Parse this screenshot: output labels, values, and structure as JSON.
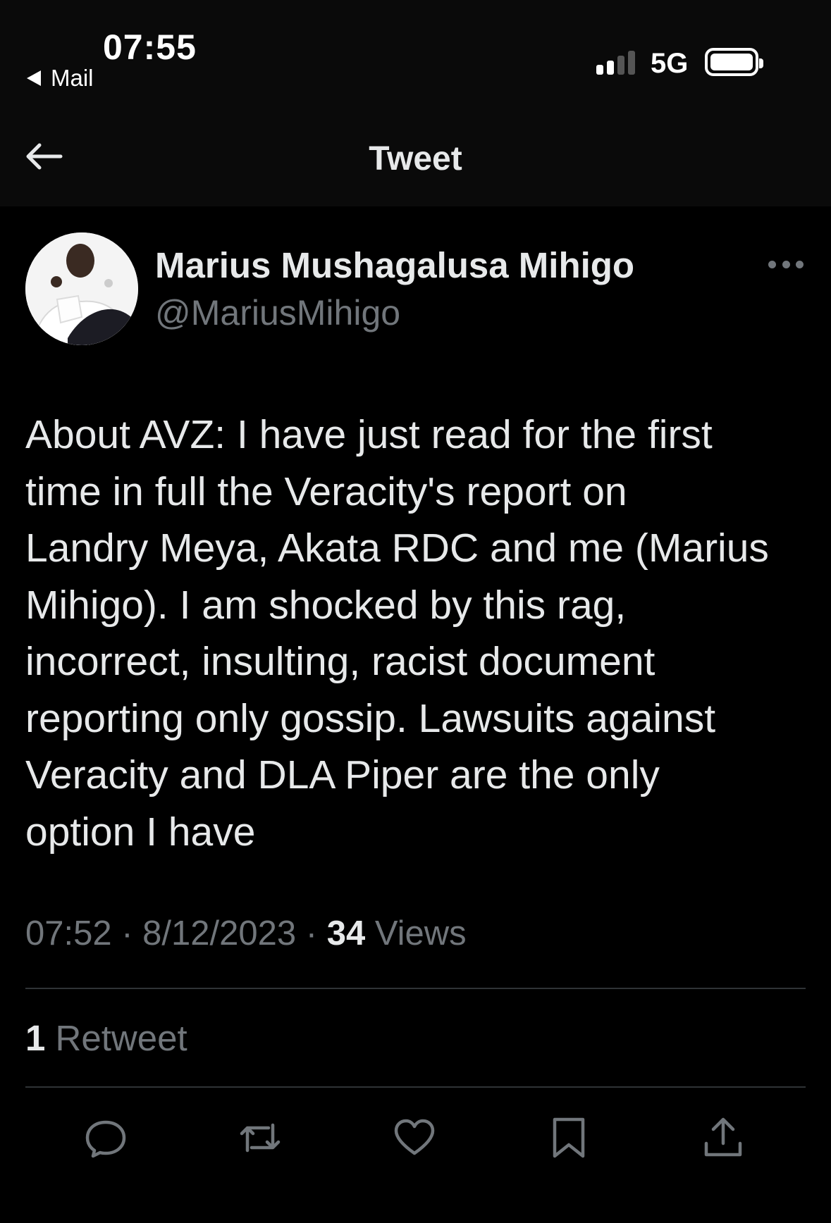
{
  "status_bar": {
    "time": "07:55",
    "back_app": "Mail",
    "network": "5G",
    "signal_icon": "signal-bars-icon",
    "battery_icon": "battery-icon"
  },
  "header": {
    "title": "Tweet",
    "back_icon": "arrow-left-icon"
  },
  "tweet": {
    "author": {
      "name": "Marius Mushagalusa Mihigo",
      "handle": "@MariusMihigo"
    },
    "text": "About AVZ: I have just read for the first\ntime in full the Veracity's report on\nLandry Meya, Akata RDC and me (Marius\nMihigo). I am shocked by this rag,\nincorrect, insulting, racist document\nreporting only gossip. Lawsuits against\nVeracity and DLA Piper are the only\noption I have",
    "time_date": "07:52 · 8/12/2023 · ",
    "views_count": "34",
    "views_label": " Views",
    "retweets_count": "1",
    "retweets_label": " Retweet"
  },
  "actions": [
    {
      "icon": "reply-icon"
    },
    {
      "icon": "retweet-icon"
    },
    {
      "icon": "like-heart-icon"
    },
    {
      "icon": "bookmark-icon"
    },
    {
      "icon": "share-icon"
    }
  ],
  "colors": {
    "background": "#000000",
    "bar_background": "#0a0a0a",
    "primary_text": "#e7e9ea",
    "secondary_text": "#71767b",
    "divider": "#2f3336"
  }
}
